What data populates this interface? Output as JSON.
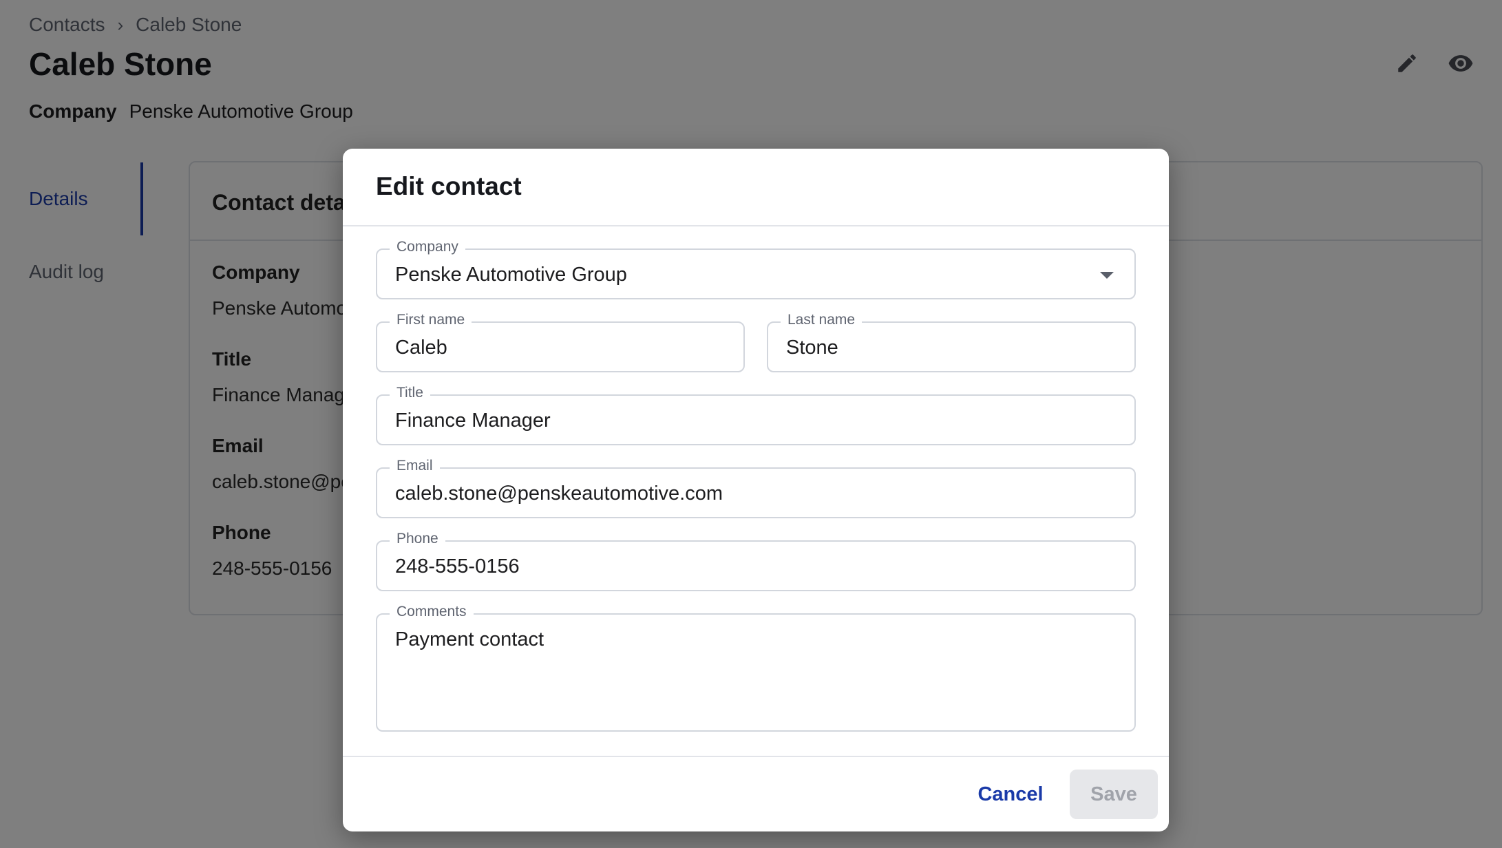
{
  "breadcrumb": {
    "root": "Contacts",
    "separator": "›",
    "current": "Caleb Stone"
  },
  "page": {
    "title": "Caleb Stone",
    "company_label": "Company",
    "company_value": "Penske Automotive Group"
  },
  "header_icons": [
    "pencil-icon",
    "eye-icon"
  ],
  "side_nav": [
    {
      "label": "Details",
      "active": true
    },
    {
      "label": "Audit log",
      "active": false
    }
  ],
  "card": {
    "title": "Contact details",
    "fields": [
      {
        "label": "Company",
        "value": "Penske Automotive Group"
      },
      {
        "label": "Title",
        "value": "Finance Manager"
      },
      {
        "label": "Email",
        "value": "caleb.stone@penskeautomotive.com"
      },
      {
        "label": "Phone",
        "value": "248-555-0156"
      }
    ]
  },
  "dialog": {
    "title": "Edit contact",
    "company": {
      "label": "Company",
      "value": "Penske Automotive Group"
    },
    "first_name": {
      "label": "First name",
      "value": "Caleb"
    },
    "last_name": {
      "label": "Last name",
      "value": "Stone"
    },
    "job_title": {
      "label": "Title",
      "value": "Finance Manager"
    },
    "email": {
      "label": "Email",
      "value": "caleb.stone@penskeautomotive.com"
    },
    "phone": {
      "label": "Phone",
      "value": "248-555-0156"
    },
    "comments": {
      "label": "Comments",
      "value": "Payment contact"
    },
    "cancel_label": "Cancel",
    "save_label": "Save"
  },
  "colors": {
    "accent": "#1a3aa8",
    "overlay": "rgba(0,0,0,0.5)",
    "save_disabled_bg": "#e6e7ea"
  }
}
